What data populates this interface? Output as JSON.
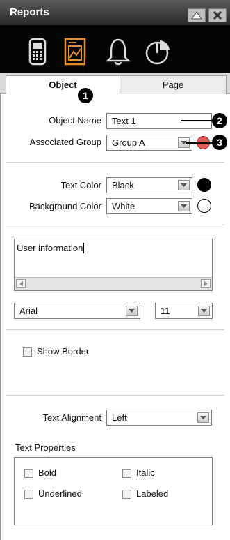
{
  "window": {
    "title": "Reports"
  },
  "toolbar": {
    "icons": [
      "phone-icon",
      "report-icon",
      "bell-icon",
      "pie-chart-icon"
    ]
  },
  "tabs": [
    {
      "label": "Object"
    },
    {
      "label": "Page"
    }
  ],
  "object": {
    "name_label": "Object Name",
    "name_value": "Text 1",
    "group_label": "Associated Group",
    "group_value": "Group A",
    "group_color": "#e05a5a",
    "text_color_label": "Text Color",
    "text_color_value": "Black",
    "text_color_swatch": "#000000",
    "bg_color_label": "Background Color",
    "bg_color_value": "White",
    "bg_color_swatch": "#ffffff",
    "text_value": "User information",
    "font_value": "Arial",
    "font_size_value": "11",
    "show_border_label": "Show Border",
    "alignment_label": "Text Alignment",
    "alignment_value": "Left",
    "properties_label": "Text Properties",
    "properties": [
      {
        "label": "Bold"
      },
      {
        "label": "Italic"
      },
      {
        "label": "Underlined"
      },
      {
        "label": "Labeled"
      }
    ]
  },
  "callouts": [
    "1",
    "2",
    "3"
  ]
}
